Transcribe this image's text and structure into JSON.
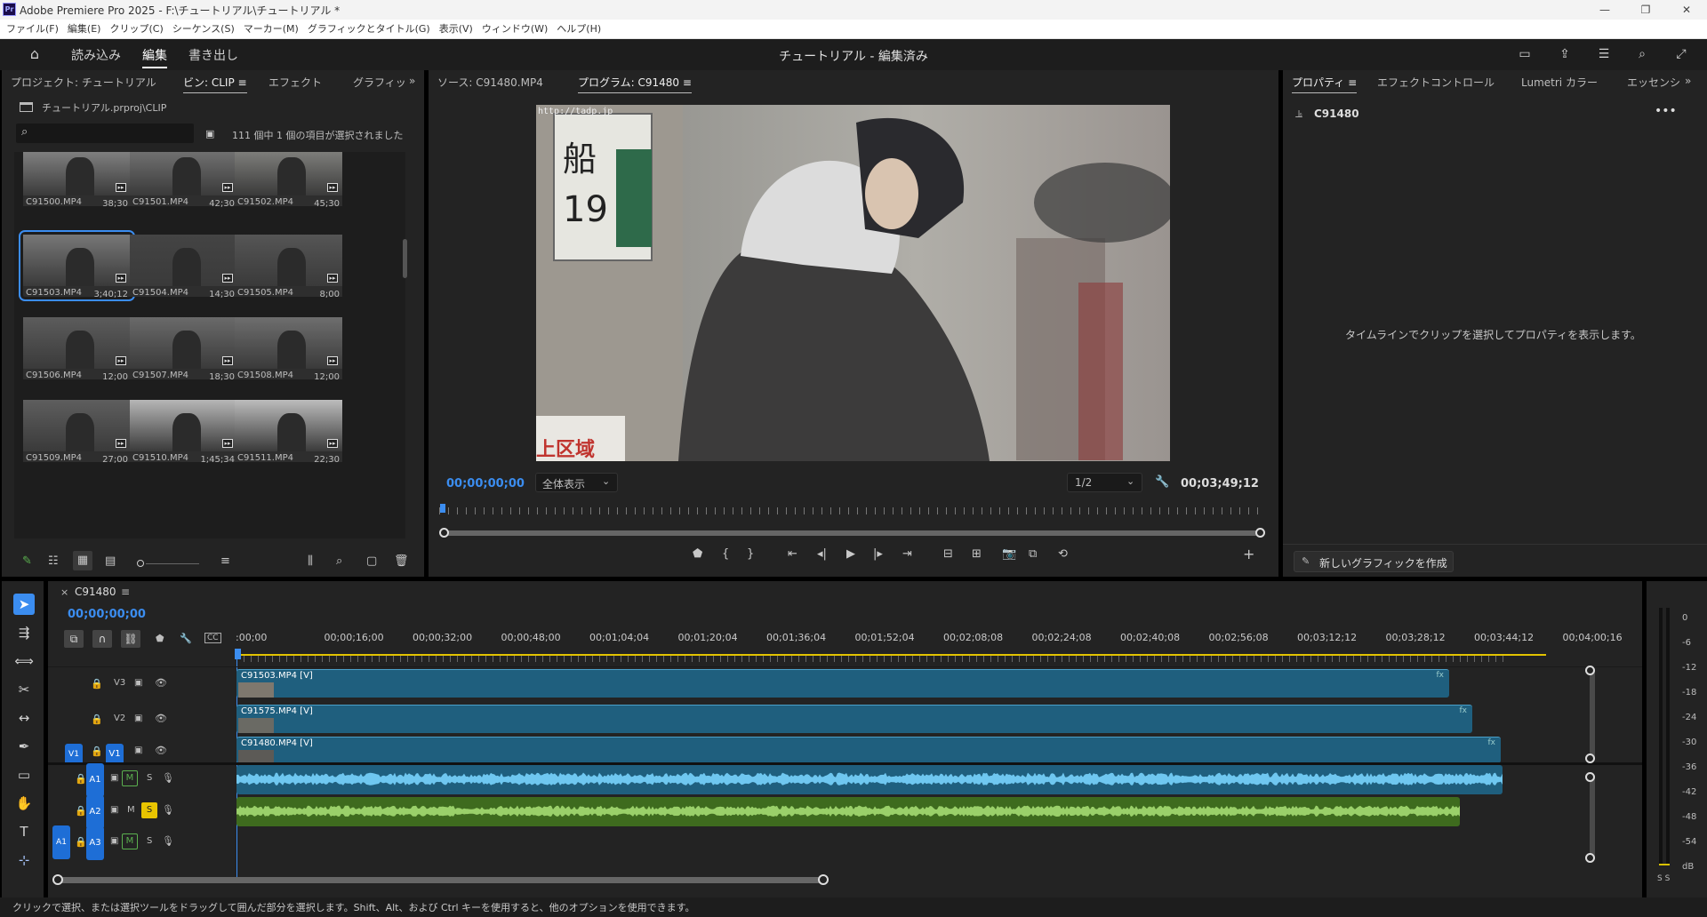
{
  "app": {
    "title": "Adobe Premiere Pro 2025 - F:\\チュートリアル\\チュートリアル *",
    "logo": "Pr"
  },
  "menu": [
    "ファイル(F)",
    "編集(E)",
    "クリップ(C)",
    "シーケンス(S)",
    "マーカー(M)",
    "グラフィックとタイトル(G)",
    "表示(V)",
    "ウィンドウ(W)",
    "ヘルプ(H)"
  ],
  "header": {
    "nav": [
      "読み込み",
      "編集",
      "書き出し"
    ],
    "active": "編集",
    "title": "チュートリアル - 編集済み",
    "icons": [
      "home-icon",
      "workspace-icon",
      "share-icon",
      "quick-export-icon",
      "search-icon",
      "fullscreen-icon"
    ]
  },
  "project": {
    "tabs": [
      "プロジェクト: チュートリアル",
      "ビン: CLIP ≡",
      "エフェクト",
      "グラフィッ"
    ],
    "active_tab": 1,
    "path": "チュートリアル.prproj\\CLIP",
    "search_placeholder": "",
    "count": "111 個中 1 個の項目が選択されました",
    "clips": [
      {
        "name": "C91500.MP4",
        "dur": "38;30"
      },
      {
        "name": "C91501.MP4",
        "dur": "42;30"
      },
      {
        "name": "C91502.MP4",
        "dur": "45;30"
      },
      {
        "name": "C91503.MP4",
        "dur": "3;40;12",
        "selected": true
      },
      {
        "name": "C91504.MP4",
        "dur": "14;30"
      },
      {
        "name": "C91505.MP4",
        "dur": "8;00"
      },
      {
        "name": "C91506.MP4",
        "dur": "12;00"
      },
      {
        "name": "C91507.MP4",
        "dur": "18;30"
      },
      {
        "name": "C91508.MP4",
        "dur": "12;00"
      },
      {
        "name": "C91509.MP4",
        "dur": "27;00"
      },
      {
        "name": "C91510.MP4",
        "dur": "1;45;34"
      },
      {
        "name": "C91511.MP4",
        "dur": "22;30"
      }
    ]
  },
  "monitor": {
    "tabs": [
      "ソース: C91480.MP4",
      "プログラム: C91480 ≡"
    ],
    "active_tab": 1,
    "timecode": "00;00;00;00",
    "zoom": "全体表示",
    "resolution": "1/2",
    "duration": "00;03;49;12",
    "video_overlay": {
      "url": "http://tadp.jp",
      "sign_char": "船",
      "sign_num": "19",
      "bottom_text": "上区域"
    }
  },
  "properties": {
    "tabs": [
      "プロパティ ≡",
      "エフェクトコントロール",
      "Lumetri カラー",
      "エッセンシ"
    ],
    "active_tab": 0,
    "clip": "C91480",
    "empty_msg": "タイムラインでクリップを選択してプロパティを表示します。",
    "new_graphic": "新しいグラフィックを作成"
  },
  "timeline": {
    "seq": "C91480",
    "timecode": "00;00;00;00",
    "ruler": [
      ":00;00",
      "00;00;16;00",
      "00;00;32;00",
      "00;00;48;00",
      "00;01;04;04",
      "00;01;20;04",
      "00;01;36;04",
      "00;01;52;04",
      "00;02;08;08",
      "00;02;24;08",
      "00;02;40;08",
      "00;02;56;08",
      "00;03;12;12",
      "00;03;28;12",
      "00;03;44;12",
      "00;04;00;16"
    ],
    "video_tracks": [
      {
        "name": "V3",
        "clip": "C91503.MP4 [V]",
        "end_frac": 0.753
      },
      {
        "name": "V2",
        "clip": "C91575.MP4 [V]",
        "end_frac": 0.767
      },
      {
        "name": "V1",
        "clip": "C91480.MP4 [V]",
        "end_frac": 0.785
      }
    ],
    "audio_tracks": [
      {
        "name": "A1",
        "m": "M",
        "s": "S"
      },
      {
        "name": "A2",
        "m": "M",
        "s": "S"
      },
      {
        "name": "A3",
        "m": "M",
        "s": "S"
      }
    ],
    "source_patch": {
      "v": "V1",
      "a": "A1"
    }
  },
  "meters": {
    "labels": [
      "0",
      "-6",
      "-12",
      "-18",
      "-24",
      "-30",
      "-36",
      "-42",
      "-48",
      "-54",
      "dB"
    ],
    "bottom": "S S"
  },
  "status": "クリックで選択、または選択ツールをドラッグして囲んだ部分を選択します。Shift、Alt、および Ctrl キーを使用すると、他のオプションを使用できます。",
  "colors": {
    "accent": "#3b8df0",
    "video_clip": "#1f5f7e",
    "audio_a1": "#1f5f7e",
    "audio_a2": "#3e6b1e",
    "solo": "#e8c400",
    "track_blue": "#1e6ed6"
  }
}
